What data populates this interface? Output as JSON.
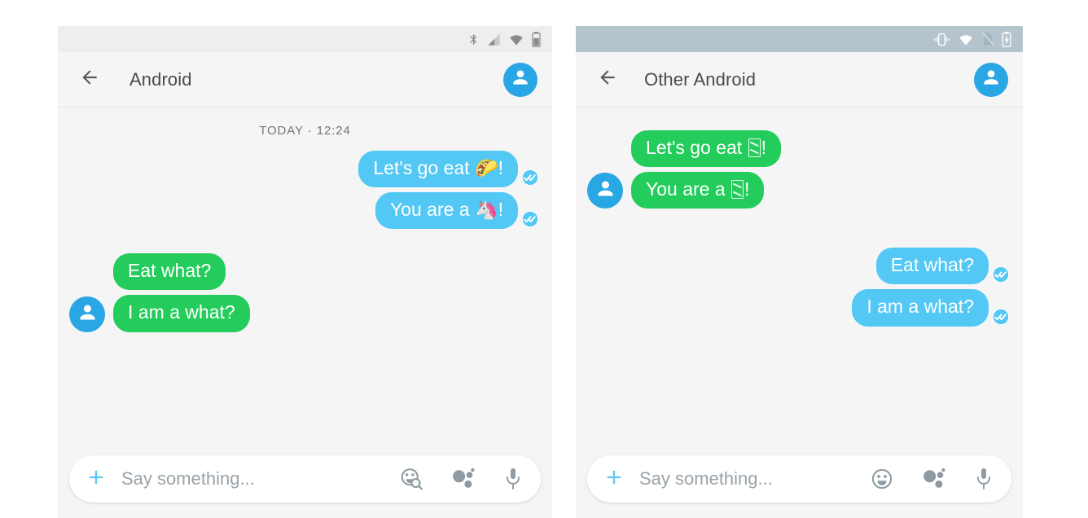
{
  "panels": [
    {
      "id": "left",
      "status_bar": {
        "background": "#eeeeee",
        "icons": [
          "bluetooth-icon",
          "cell-signal-icon",
          "wifi-icon",
          "battery-icon"
        ]
      },
      "app_bar": {
        "back_icon": "back-arrow-icon",
        "title": "Android",
        "avatar_icon": "contact-avatar-icon"
      },
      "thread": {
        "day_divider": "TODAY · 12:24",
        "messages": [
          {
            "side": "out",
            "color": "blue",
            "text": "Let's go eat 🌮!",
            "has_tick": true,
            "has_avatar": false,
            "tofu": false
          },
          {
            "side": "out",
            "color": "blue",
            "text": "You are a 🦄!",
            "has_tick": true,
            "has_avatar": false,
            "tofu": false
          },
          {
            "side": "in",
            "color": "green",
            "text": "Eat what?",
            "has_tick": false,
            "has_avatar": false,
            "tofu": false
          },
          {
            "side": "in",
            "color": "green",
            "text": "I am a what?",
            "has_tick": false,
            "has_avatar": true,
            "tofu": false
          }
        ]
      },
      "composer": {
        "plus_icon": "plus-icon",
        "placeholder": "Say something...",
        "icons": [
          "emoji-search-icon",
          "assistant-dots-icon",
          "microphone-icon"
        ]
      }
    },
    {
      "id": "right",
      "status_bar": {
        "background": "#b5c4cc",
        "icons": [
          "vibrate-icon",
          "wifi-icon",
          "no-sim-icon",
          "battery-charging-icon"
        ]
      },
      "app_bar": {
        "back_icon": "back-arrow-icon",
        "title": "Other Android",
        "avatar_icon": "contact-avatar-icon"
      },
      "thread": {
        "day_divider": "",
        "messages": [
          {
            "side": "in",
            "color": "green",
            "text_before": "Let's go eat ",
            "text_after": "!",
            "has_tick": false,
            "has_avatar": false,
            "tofu": true
          },
          {
            "side": "in",
            "color": "green",
            "text_before": "You are a ",
            "text_after": "!",
            "has_tick": false,
            "has_avatar": true,
            "tofu": true
          },
          {
            "side": "out",
            "color": "blue",
            "text": "Eat what?",
            "has_tick": true,
            "has_avatar": false,
            "tofu": false
          },
          {
            "side": "out",
            "color": "blue",
            "text": "I am a what?",
            "has_tick": true,
            "has_avatar": false,
            "tofu": false
          }
        ]
      },
      "composer": {
        "plus_icon": "plus-icon",
        "placeholder": "Say something...",
        "icons": [
          "emoji-icon",
          "assistant-dots-icon",
          "microphone-icon"
        ]
      }
    }
  ],
  "colors": {
    "bubble_outgoing": "#53c8f5",
    "bubble_incoming": "#24cc5c",
    "accent_blue": "#29a6e4",
    "app_bar_bg": "#f5f5f5",
    "thread_bg": "#f5f5f5",
    "status_left_bg": "#eeeeee",
    "status_right_bg": "#b5c4cc",
    "title_text": "#4a4a4a",
    "placeholder_text": "#9aa2a8",
    "divider_text": "#757575"
  }
}
